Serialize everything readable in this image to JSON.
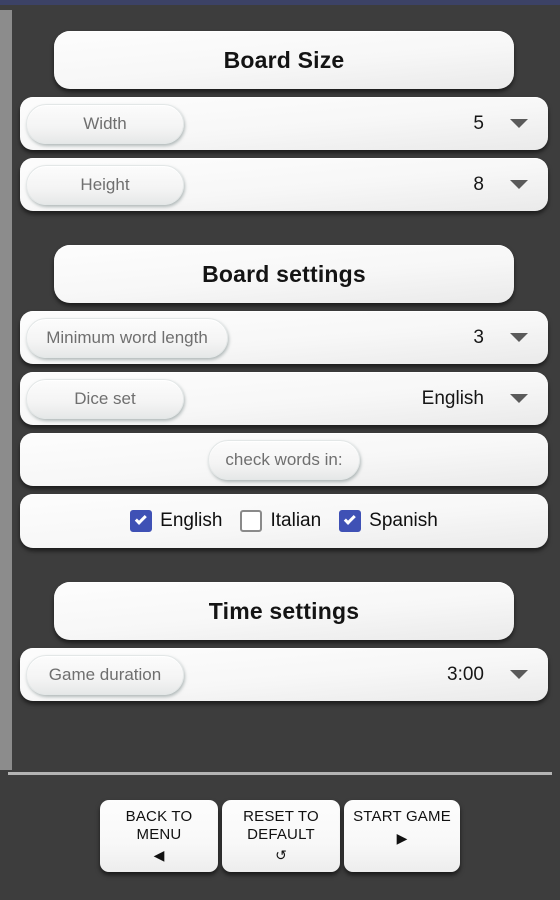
{
  "theme": {
    "background": "#3d3d3d",
    "statusbar": "#3c4266",
    "card": "#f7f7f7",
    "checkbox_on": "#3f51b5",
    "checkbox_off_border": "#8a8a8a",
    "divider": "#b4b4b4",
    "scrollbar": "#8c8c8c"
  },
  "sections": [
    {
      "title": "Board Size",
      "rows": [
        {
          "label": "Width",
          "value": "5",
          "icon": "chevron-down-icon"
        },
        {
          "label": "Height",
          "value": "8",
          "icon": "chevron-down-icon"
        }
      ]
    },
    {
      "title": "Board settings",
      "rows": [
        {
          "label": "Minimum word length",
          "value": "3",
          "icon": "chevron-down-icon"
        },
        {
          "label": "Dice set",
          "value": "English",
          "icon": "chevron-down-icon"
        }
      ],
      "check_words_label": "check words in:",
      "languages": [
        {
          "label": "English",
          "checked": true
        },
        {
          "label": "Italian",
          "checked": false
        },
        {
          "label": "Spanish",
          "checked": true
        }
      ]
    },
    {
      "title": "Time settings",
      "rows": [
        {
          "label": "Game duration",
          "value": "3:00",
          "icon": "chevron-down-icon"
        }
      ]
    }
  ],
  "buttons": [
    {
      "label": "BACK TO\nMENU",
      "line1": "BACK TO",
      "line2": "MENU",
      "icon": "◀",
      "icon_name": "triangle-left-icon"
    },
    {
      "label": "RESET TO\nDEFAULT",
      "line1": "RESET TO",
      "line2": "DEFAULT",
      "icon": "↺",
      "icon_name": "reset-circular-arrow-icon"
    },
    {
      "label": "START GAME",
      "line1": "START GAME",
      "line2": "",
      "icon": "▶",
      "icon_name": "triangle-right-icon"
    }
  ]
}
